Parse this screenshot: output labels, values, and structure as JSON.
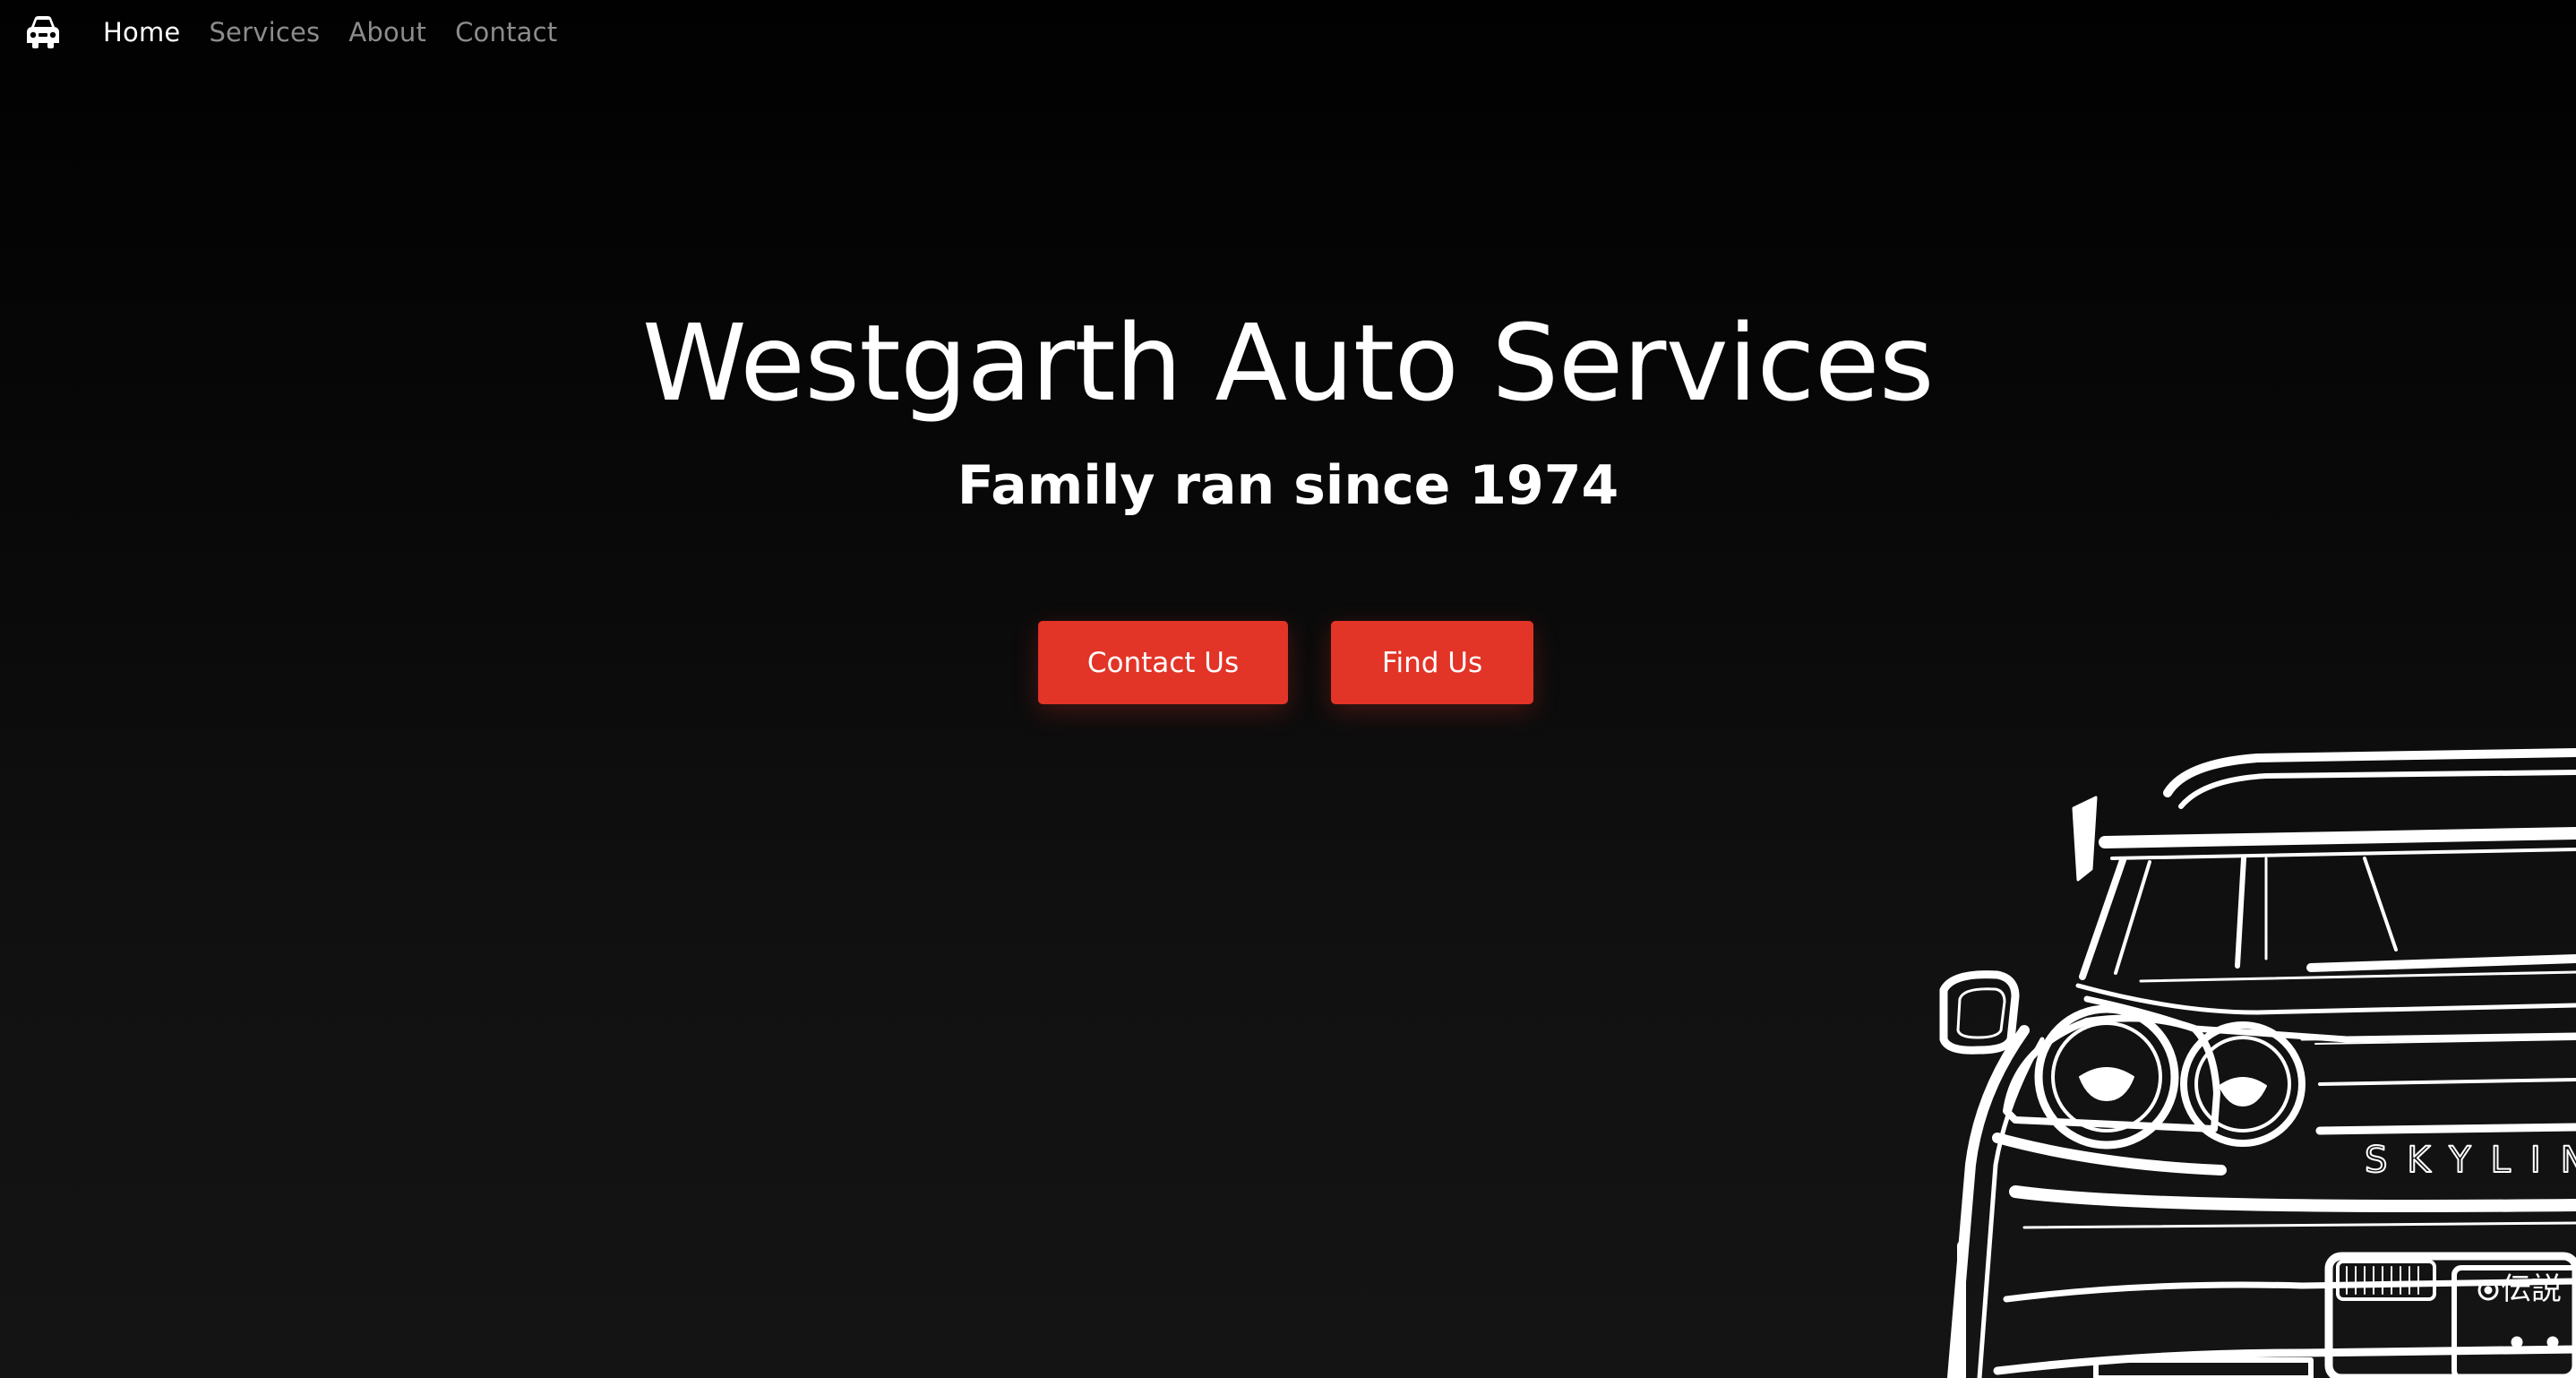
{
  "nav": {
    "brand_icon": "car-icon",
    "links": [
      {
        "label": "Home",
        "active": true
      },
      {
        "label": "Services",
        "active": false
      },
      {
        "label": "About",
        "active": false
      },
      {
        "label": "Contact",
        "active": false
      }
    ]
  },
  "hero": {
    "title": "Westgarth Auto Services",
    "subtitle": "Family ran since 1974",
    "buttons": {
      "contact_label": "Contact Us",
      "find_label": "Find Us"
    }
  },
  "colors": {
    "accent": "#e23427",
    "background": "#0a0a0a",
    "text": "#ffffff",
    "nav_inactive": "#8c8c8c"
  },
  "illustration": {
    "name": "skyline-car-rear-illustration",
    "badge_text": "SKYLINE",
    "plate_text": "伝説"
  }
}
